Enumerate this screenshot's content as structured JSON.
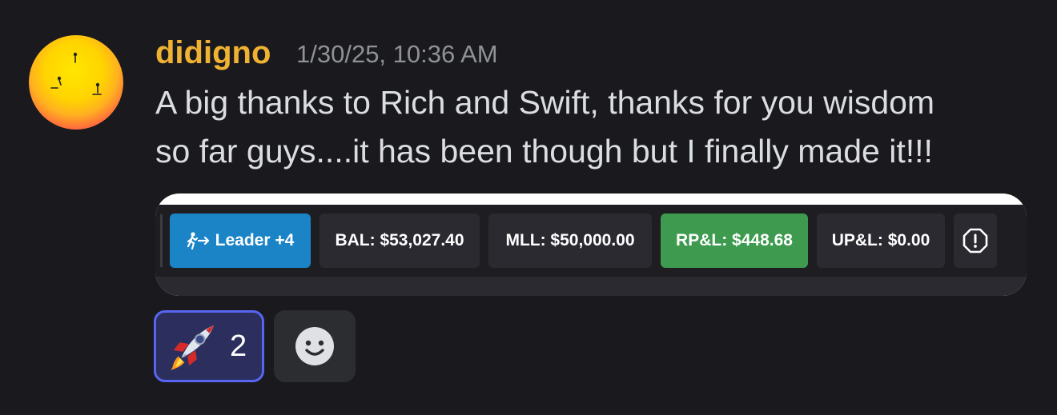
{
  "message": {
    "username": "didigno",
    "timestamp": "1/30/25, 10:36 AM",
    "text_line_1": "A big thanks to Rich and Swift, thanks for you wisdom",
    "text_line_2": "so far guys....it has been though but I finally made it!!!",
    "username_color": "#f0b232"
  },
  "embed": {
    "stats": {
      "leader_label": "Leader +4",
      "balance": "BAL: $53,027.40",
      "mll": "MLL: $50,000.00",
      "rpnl": "RP&L: $448.68",
      "upnl": "UP&L: $0.00"
    },
    "colors": {
      "leader": "#1a84c7",
      "rpnl": "#3d9a4e",
      "neutral": "#2a2a30"
    },
    "icons": [
      "person-running-arrow-icon",
      "alert-octagon-icon"
    ]
  },
  "reactions": [
    {
      "emoji": "rocket",
      "count": "2",
      "selected": true
    }
  ],
  "add_reaction": {
    "icon": "smiley-face-icon"
  }
}
